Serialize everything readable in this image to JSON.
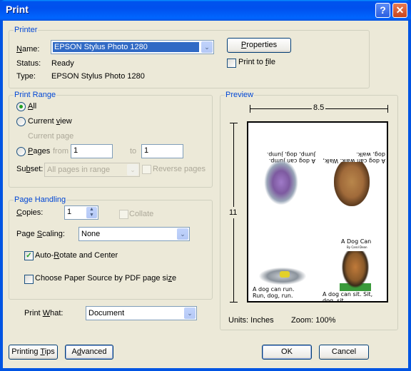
{
  "window": {
    "title": "Print",
    "help_glyph": "?",
    "close_glyph": "✕"
  },
  "printer": {
    "group_label": "Printer",
    "name_label": "Name:",
    "name_value": "EPSON Stylus Photo 1280",
    "status_label": "Status:",
    "status_value": "Ready",
    "type_label": "Type:",
    "type_value": "EPSON Stylus Photo 1280",
    "properties_button": "Properties",
    "print_to_file_label": "Print to file",
    "print_to_file_checked": false
  },
  "print_range": {
    "group_label": "Print Range",
    "all_label": "All",
    "current_view_label": "Current view",
    "current_page_label": "Current page",
    "pages_label": "Pages",
    "from_label": "from",
    "from_value": "1",
    "to_label": "to",
    "to_value": "1",
    "selected": "all",
    "subset_label": "Subset:",
    "subset_value": "All pages in range",
    "reverse_pages_label": "Reverse pages"
  },
  "page_handling": {
    "group_label": "Page Handling",
    "copies_label": "Copies:",
    "copies_value": "1",
    "collate_label": "Collate",
    "page_scaling_label": "Page Scaling:",
    "page_scaling_value": "None",
    "auto_rotate_label": "Auto-Rotate and Center",
    "auto_rotate_checked": true,
    "paper_source_label": "Choose Paper Source by PDF page size",
    "paper_source_checked": false
  },
  "print_what": {
    "label": "Print What:",
    "value": "Document"
  },
  "preview": {
    "group_label": "Preview",
    "width_dimension": "8.5",
    "height_dimension": "11",
    "units": "Units: Inches",
    "zoom": "Zoom: 100%",
    "page_text": {
      "walk": "A dog can walk. Walk, dog, walk.",
      "jump": "A dog can jump. Jump, dog, jump.",
      "title": "A Dog Can",
      "byline": "By Carol Dean",
      "run": "A dog can run. Run, dog, run.",
      "sit": "A dog can sit. Sit, dog, sit."
    }
  },
  "buttons": {
    "printing_tips": "Printing Tips",
    "advanced": "Advanced",
    "ok": "OK",
    "cancel": "Cancel"
  },
  "icons": {
    "dropdown_arrow": "⌄",
    "check": "✓",
    "spin_up": "▲",
    "spin_down": "▼"
  }
}
